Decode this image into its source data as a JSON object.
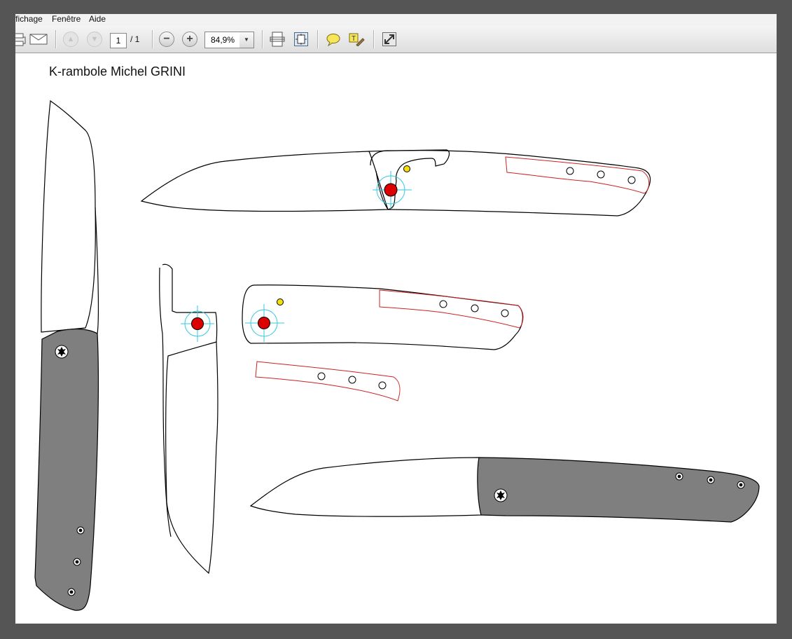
{
  "menu": {
    "items": [
      "ffichage",
      "Fenêtre",
      "Aide"
    ]
  },
  "toolbar": {
    "page_current": "1",
    "page_total": "/ 1",
    "zoom": "84,9%",
    "icons": [
      "print-icon",
      "email-icon",
      "prev-page-icon",
      "next-page-icon",
      "zoom-out-icon",
      "zoom-in-icon",
      "zoom-dropdown-icon",
      "fit-width-icon",
      "fit-page-icon",
      "comment-icon",
      "highlight-icon",
      "expand-icon"
    ]
  },
  "document": {
    "title": "K-rambole Michel GRINI"
  },
  "colors": {
    "handle_fill": "#7f7f7f",
    "pivot": "#dd0000",
    "pin": "#f5e000",
    "guide": "#33c9e0",
    "template_outline": "#cc2222"
  }
}
